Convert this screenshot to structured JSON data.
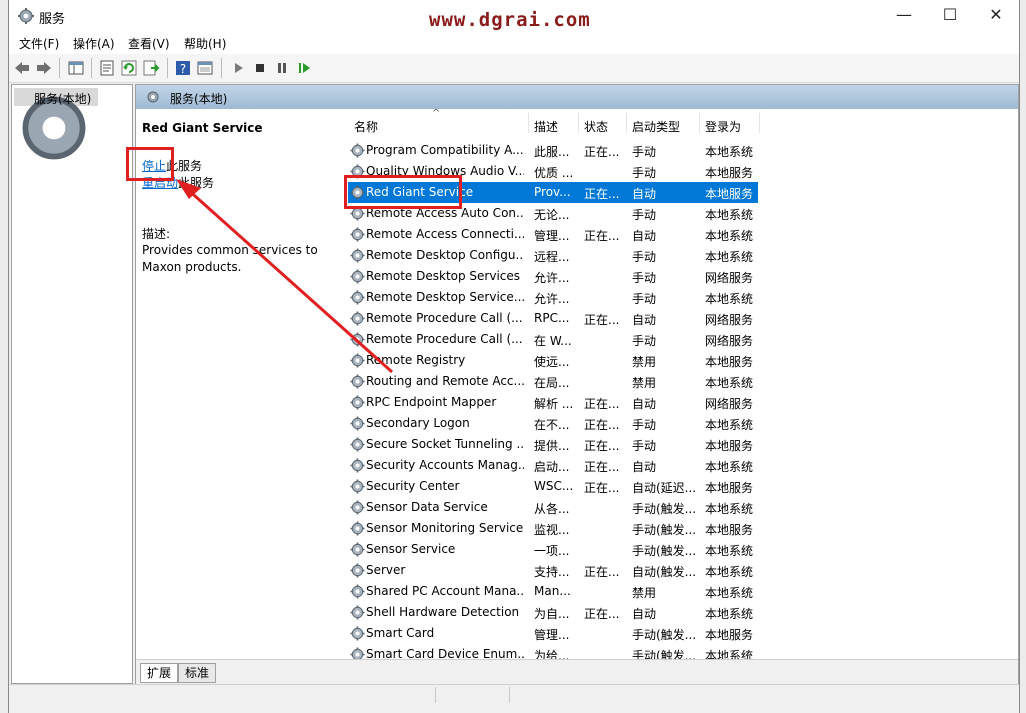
{
  "window": {
    "title": "服务",
    "watermark": "www.dgrai.com",
    "minimize": "—",
    "maximize": "☐",
    "close": "✕"
  },
  "menu": [
    "文件(F)",
    "操作(A)",
    "查看(V)",
    "帮助(H)"
  ],
  "tree": {
    "root": "服务(本地)"
  },
  "pane": {
    "header": "服务(本地)",
    "service_title": "Red Giant Service",
    "stop_link": "停止",
    "stop_suffix": "此服务",
    "restart_link": "重启动",
    "restart_suffix": "此服务",
    "desc_label": "描述:",
    "desc_text": "Provides common services to Maxon products."
  },
  "columns": {
    "name": "名称",
    "desc": "描述",
    "status": "状态",
    "startup": "启动类型",
    "logon": "登录为"
  },
  "rows": [
    {
      "name": "Program Compatibility A...",
      "desc": "此服...",
      "status": "正在...",
      "startup": "手动",
      "logon": "本地系统"
    },
    {
      "name": "Quality Windows Audio V...",
      "desc": "优质 ...",
      "status": "",
      "startup": "手动",
      "logon": "本地服务"
    },
    {
      "name": "Red Giant Service",
      "desc": "Prov...",
      "status": "正在...",
      "startup": "自动",
      "logon": "本地服务"
    },
    {
      "name": "Remote Access Auto Con...",
      "desc": "无论...",
      "status": "",
      "startup": "手动",
      "logon": "本地系统"
    },
    {
      "name": "Remote Access Connecti...",
      "desc": "管理...",
      "status": "正在...",
      "startup": "自动",
      "logon": "本地系统"
    },
    {
      "name": "Remote Desktop Configu...",
      "desc": "远程...",
      "status": "",
      "startup": "手动",
      "logon": "本地系统"
    },
    {
      "name": "Remote Desktop Services",
      "desc": "允许...",
      "status": "",
      "startup": "手动",
      "logon": "网络服务"
    },
    {
      "name": "Remote Desktop Service...",
      "desc": "允许...",
      "status": "",
      "startup": "手动",
      "logon": "本地系统"
    },
    {
      "name": "Remote Procedure Call (...",
      "desc": "RPC...",
      "status": "正在...",
      "startup": "自动",
      "logon": "网络服务"
    },
    {
      "name": "Remote Procedure Call (...",
      "desc": "在 W...",
      "status": "",
      "startup": "手动",
      "logon": "网络服务"
    },
    {
      "name": "Remote Registry",
      "desc": "使远...",
      "status": "",
      "startup": "禁用",
      "logon": "本地服务"
    },
    {
      "name": "Routing and Remote Acc...",
      "desc": "在局...",
      "status": "",
      "startup": "禁用",
      "logon": "本地系统"
    },
    {
      "name": "RPC Endpoint Mapper",
      "desc": "解析 ...",
      "status": "正在...",
      "startup": "自动",
      "logon": "网络服务"
    },
    {
      "name": "Secondary Logon",
      "desc": "在不...",
      "status": "正在...",
      "startup": "手动",
      "logon": "本地系统"
    },
    {
      "name": "Secure Socket Tunneling ...",
      "desc": "提供...",
      "status": "正在...",
      "startup": "手动",
      "logon": "本地服务"
    },
    {
      "name": "Security Accounts Manag...",
      "desc": "启动...",
      "status": "正在...",
      "startup": "自动",
      "logon": "本地系统"
    },
    {
      "name": "Security Center",
      "desc": "WSC...",
      "status": "正在...",
      "startup": "自动(延迟...",
      "logon": "本地服务"
    },
    {
      "name": "Sensor Data Service",
      "desc": "从各...",
      "status": "",
      "startup": "手动(触发...",
      "logon": "本地系统"
    },
    {
      "name": "Sensor Monitoring Service",
      "desc": "监视...",
      "status": "",
      "startup": "手动(触发...",
      "logon": "本地服务"
    },
    {
      "name": "Sensor Service",
      "desc": "一项...",
      "status": "",
      "startup": "手动(触发...",
      "logon": "本地系统"
    },
    {
      "name": "Server",
      "desc": "支持...",
      "status": "正在...",
      "startup": "自动(触发...",
      "logon": "本地系统"
    },
    {
      "name": "Shared PC Account Mana...",
      "desc": "Man...",
      "status": "",
      "startup": "禁用",
      "logon": "本地系统"
    },
    {
      "name": "Shell Hardware Detection",
      "desc": "为自...",
      "status": "正在...",
      "startup": "自动",
      "logon": "本地系统"
    },
    {
      "name": "Smart Card",
      "desc": "管理...",
      "status": "",
      "startup": "手动(触发...",
      "logon": "本地服务"
    },
    {
      "name": "Smart Card Device Enum...",
      "desc": "为给...",
      "status": "",
      "startup": "手动(触发...",
      "logon": "本地系统"
    }
  ],
  "selected_row_index": 2,
  "tabs": [
    "扩展",
    "标准"
  ],
  "colors": {
    "selection": "#0078d7",
    "highlight_box": "#e02020",
    "link": "#0066cc",
    "watermark": "#8b1a1a"
  }
}
